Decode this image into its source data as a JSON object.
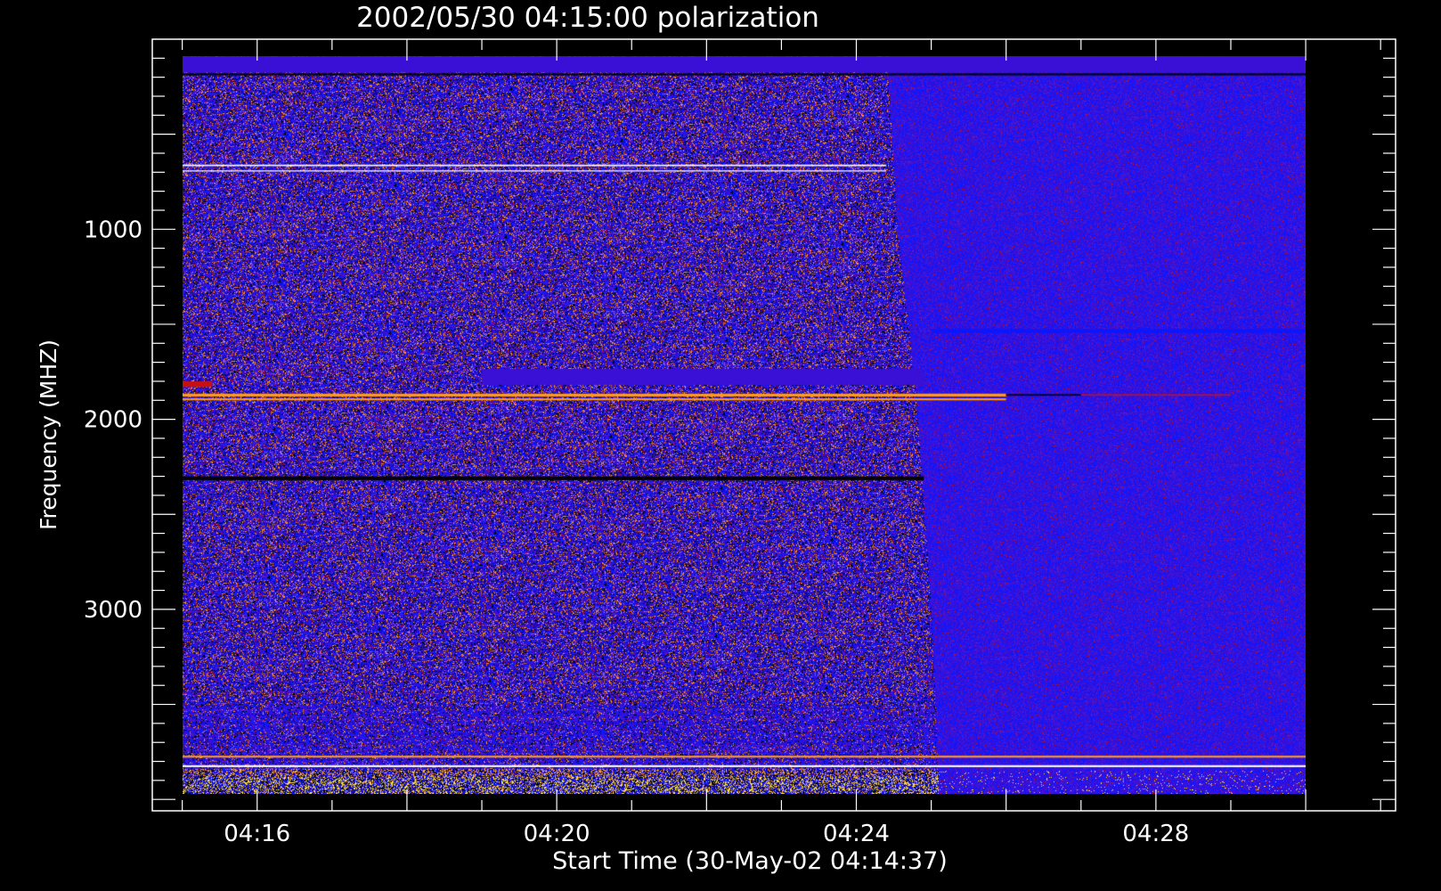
{
  "chart_data": {
    "type": "heatmap",
    "title": "2002/05/30 04:15:00 polarization",
    "xlabel": "Start Time (30-May-02 04:14:37)",
    "ylabel": "Frequency (MHZ)",
    "x_ticks": [
      {
        "minutes": 16,
        "label": "04:16"
      },
      {
        "minutes": 20,
        "label": "04:20"
      },
      {
        "minutes": 24,
        "label": "04:24"
      },
      {
        "minutes": 28,
        "label": "04:28"
      }
    ],
    "y_ticks": [
      {
        "value": 1000,
        "label": "1000"
      },
      {
        "value": 2000,
        "label": "2000"
      },
      {
        "value": 3000,
        "label": "3000"
      }
    ],
    "x_range_minutes": [
      14.6,
      31.2
    ],
    "y_range_mhz": [
      0,
      4060
    ],
    "data_x_range_minutes": [
      15.0,
      30.0
    ],
    "data_y_range_mhz": [
      90,
      3970
    ],
    "transition_minutes": [
      [
        90,
        24.4
      ],
      [
        1000,
        24.55
      ],
      [
        1900,
        24.8
      ],
      [
        3000,
        25.0
      ],
      [
        3970,
        25.1
      ]
    ],
    "grid": false,
    "palette": {
      "background": "#000000",
      "axes": "#ffffff",
      "base": "#3a10d6",
      "blue": "#0a16ff",
      "purple": "#5a18c8",
      "dark": "#000000",
      "orange": "#ff9a1c",
      "red": "#c81010",
      "yellow": "#ffe23a",
      "white": "#ffffff"
    }
  }
}
